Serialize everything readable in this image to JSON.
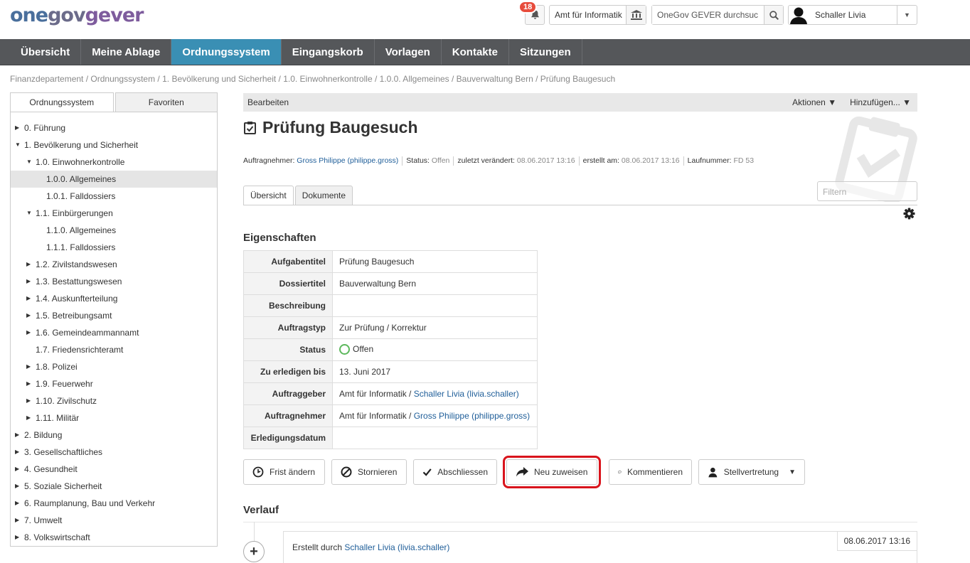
{
  "brand": {
    "logo_a": "one",
    "logo_b": "gov",
    "logo_c": "gever"
  },
  "header": {
    "notifications_count": "18",
    "org_unit": "Amt für Informatik",
    "search_placeholder": "OneGov GEVER durchsuchen",
    "search_value": "OneGov GEVER durchsuc",
    "user_name": "Schaller Livia"
  },
  "nav": [
    {
      "label": "Übersicht"
    },
    {
      "label": "Meine Ablage"
    },
    {
      "label": "Ordnungssystem"
    },
    {
      "label": "Eingangskorb"
    },
    {
      "label": "Vorlagen"
    },
    {
      "label": "Kontakte"
    },
    {
      "label": "Sitzungen"
    }
  ],
  "breadcrumb": "Finanzdepartement / Ordnungssystem / 1. Bevölkerung und Sicherheit / 1.0. Einwohnerkontrolle / 1.0.0. Allgemeines / Bauverwaltung Bern / Prüfung Baugesuch",
  "sidebar": {
    "tab_active": "Ordnungssystem",
    "tab_inactive": "Favoriten",
    "tree": [
      {
        "label": "0. Führung",
        "level": 0,
        "state": "collapsed"
      },
      {
        "label": "1. Bevölkerung und Sicherheit",
        "level": 0,
        "state": "expanded"
      },
      {
        "label": "1.0. Einwohnerkontrolle",
        "level": 1,
        "state": "expanded"
      },
      {
        "label": "1.0.0. Allgemeines",
        "level": 2,
        "state": "leaf",
        "selected": true
      },
      {
        "label": "1.0.1. Falldossiers",
        "level": 2,
        "state": "leaf"
      },
      {
        "label": "1.1. Einbürgerungen",
        "level": 1,
        "state": "expanded"
      },
      {
        "label": "1.1.0. Allgemeines",
        "level": 2,
        "state": "leaf"
      },
      {
        "label": "1.1.1. Falldossiers",
        "level": 2,
        "state": "leaf"
      },
      {
        "label": "1.2. Zivilstandswesen",
        "level": 1,
        "state": "collapsed"
      },
      {
        "label": "1.3. Bestattungswesen",
        "level": 1,
        "state": "collapsed"
      },
      {
        "label": "1.4. Auskunfterteilung",
        "level": 1,
        "state": "collapsed"
      },
      {
        "label": "1.5. Betreibungsamt",
        "level": 1,
        "state": "collapsed"
      },
      {
        "label": "1.6. Gemeindeammannamt",
        "level": 1,
        "state": "collapsed"
      },
      {
        "label": "1.7. Friedensrichteramt",
        "level": 1,
        "state": "leaf"
      },
      {
        "label": "1.8. Polizei",
        "level": 1,
        "state": "collapsed"
      },
      {
        "label": "1.9. Feuerwehr",
        "level": 1,
        "state": "collapsed"
      },
      {
        "label": "1.10. Zivilschutz",
        "level": 1,
        "state": "collapsed"
      },
      {
        "label": "1.11. Militär",
        "level": 1,
        "state": "collapsed"
      },
      {
        "label": "2. Bildung",
        "level": 0,
        "state": "collapsed"
      },
      {
        "label": "3. Gesellschaftliches",
        "level": 0,
        "state": "collapsed"
      },
      {
        "label": "4. Gesundheit",
        "level": 0,
        "state": "collapsed"
      },
      {
        "label": "5. Soziale Sicherheit",
        "level": 0,
        "state": "collapsed"
      },
      {
        "label": "6. Raumplanung, Bau und Verkehr",
        "level": 0,
        "state": "collapsed"
      },
      {
        "label": "7. Umwelt",
        "level": 0,
        "state": "collapsed"
      },
      {
        "label": "8. Volkswirtschaft",
        "level": 0,
        "state": "collapsed"
      }
    ]
  },
  "toolbar": {
    "edit": "Bearbeiten",
    "actions": "Aktionen ▼",
    "add": "Hinzufügen... ▼"
  },
  "task": {
    "title": "Prüfung Baugesuch",
    "meta": {
      "assignee_label": "Auftragnehmer:",
      "assignee": "Gross Philippe (philippe.gross)",
      "status_label": "Status:",
      "status": "Offen",
      "modified_label": "zuletzt verändert:",
      "modified": "08.06.2017 13:16",
      "created_label": "erstellt am:",
      "created": "08.06.2017 13:16",
      "seq_label": "Laufnummer:",
      "seq": "FD 53"
    }
  },
  "content_tabs": {
    "overview": "Übersicht",
    "documents": "Dokumente"
  },
  "filter_placeholder": "Filtern",
  "properties": {
    "heading": "Eigenschaften",
    "rows": [
      {
        "label": "Aufgabentitel",
        "value": "Prüfung Baugesuch"
      },
      {
        "label": "Dossiertitel",
        "value": "Bauverwaltung Bern"
      },
      {
        "label": "Beschreibung",
        "value": ""
      },
      {
        "label": "Auftragstyp",
        "value": "Zur Prüfung / Korrektur"
      },
      {
        "label": "Status",
        "value": "Offen"
      },
      {
        "label": "Zu erledigen bis",
        "value": "13. Juni 2017"
      },
      {
        "label": "Auftraggeber",
        "value": "Amt für Informatik / ",
        "link": "Schaller Livia (livia.schaller)"
      },
      {
        "label": "Auftragnehmer",
        "value": "Amt für Informatik / ",
        "link": "Gross Philippe (philippe.gross)"
      },
      {
        "label": "Erledigungsdatum",
        "value": ""
      }
    ]
  },
  "actions": {
    "change_deadline": "Frist ändern",
    "cancel": "Stornieren",
    "close": "Abschliessen",
    "reassign": "Neu zuweisen",
    "comment": "Kommentieren",
    "delegate": "Stellvertretung"
  },
  "history": {
    "heading": "Verlauf",
    "entry_text": "Erstellt durch ",
    "entry_user": "Schaller Livia (livia.schaller)",
    "entry_date": "08.06.2017 13:16"
  },
  "colors": {
    "nav_bg": "#55575a",
    "nav_active": "#3a8fb4",
    "link": "#1f5e99",
    "badge": "#e74c3c",
    "highlight": "#d9141c",
    "status_open": "#5cb85c"
  }
}
